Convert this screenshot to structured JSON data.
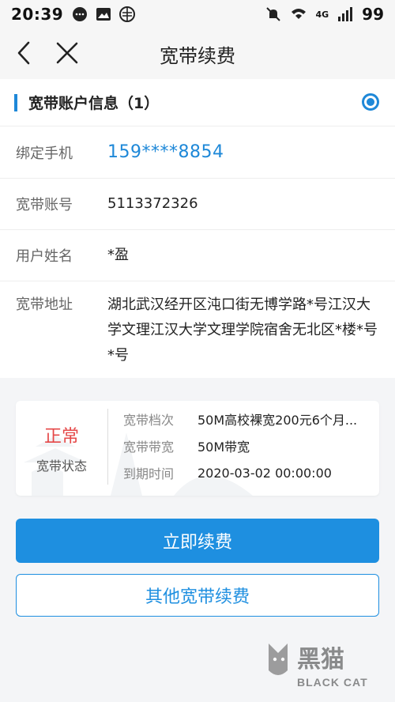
{
  "status_bar": {
    "time": "20:39",
    "network": "4G",
    "battery": "99",
    "icons": [
      "message-bubble-icon",
      "image-icon",
      "sim-icon",
      "mute-icon",
      "wifi-icon",
      "signal-icon"
    ]
  },
  "header": {
    "title": "宽带续费",
    "back_icon": "back-chevron-icon",
    "close_icon": "close-x-icon"
  },
  "account_section": {
    "title": "宽带账户信息（1）",
    "rows": [
      {
        "label": "绑定手机",
        "value": "159****8854"
      },
      {
        "label": "宽带账号",
        "value": "5113372326"
      },
      {
        "label": "用户姓名",
        "value": "*盈"
      },
      {
        "label": "宽带地址",
        "value": "湖北武汉经开区沌口街无博学路*号江汉大学文理江汉大学文理学院宿舍无北区*楼*号*号"
      }
    ]
  },
  "status_card": {
    "status": "正常",
    "status_label": "宽带状态",
    "details": [
      {
        "key": "宽带档次",
        "value": "50M高校裸宽200元6个月..."
      },
      {
        "key": "宽带带宽",
        "value": "50M带宽"
      },
      {
        "key": "到期时间",
        "value": "2020-03-02 00:00:00"
      }
    ]
  },
  "buttons": {
    "renew_now": "立即续费",
    "other_renew": "其他宽带续费"
  },
  "watermark": {
    "brand_cn": "黑猫",
    "brand_en": "BLACK CAT"
  },
  "colors": {
    "accent": "#1e8fe0",
    "status_normal": "#e54848",
    "background": "#f4f5f7"
  }
}
